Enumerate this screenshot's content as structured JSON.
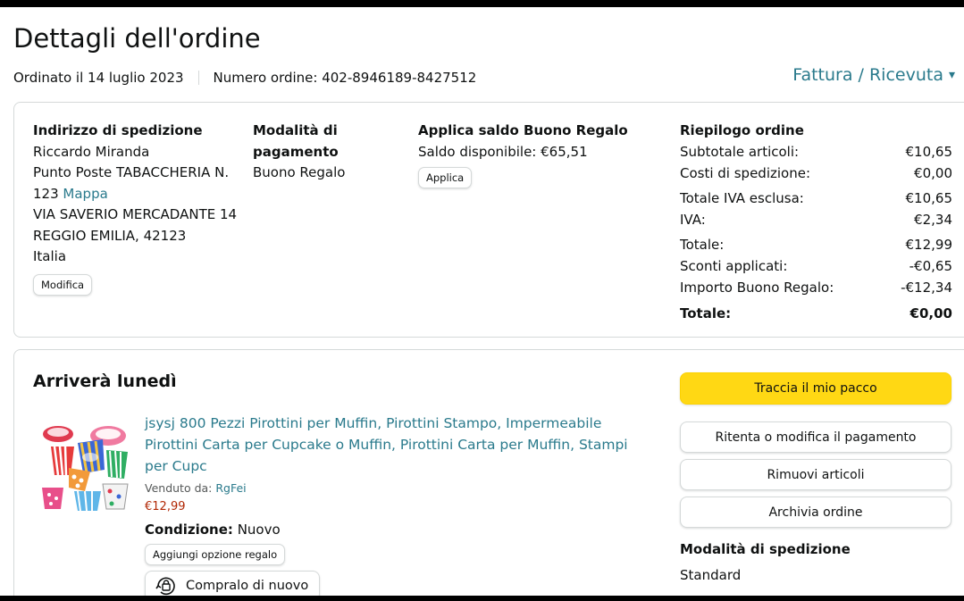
{
  "header": {
    "title": "Dettagli dell'ordine",
    "order_date": "Ordinato il 14 luglio 2023",
    "order_number": "Numero ordine: 402-8946189-8427512",
    "invoice_link": "Fattura / Ricevuta"
  },
  "shipping_address": {
    "heading": "Indirizzo di spedizione",
    "lines": [
      "Riccardo Miranda",
      "Punto Poste TABACCHERIA N.",
      "123"
    ],
    "map_link": "Mappa",
    "lines2": [
      "VIA SAVERIO MERCADANTE 14",
      "REGGIO EMILIA, 42123",
      "Italia"
    ],
    "edit_button": "Modifica"
  },
  "payment": {
    "heading_line1": "Modalità di",
    "heading_line2": "pagamento",
    "method": "Buono Regalo"
  },
  "gift_balance": {
    "heading": "Applica saldo Buono Regalo",
    "balance": "Saldo disponibile: €65,51",
    "apply_button": "Applica"
  },
  "summary": {
    "heading": "Riepilogo ordine",
    "rows": [
      {
        "label": "Subtotale articoli:",
        "value": "€10,65"
      },
      {
        "label": "Costi di spedizione:",
        "value": "€0,00"
      },
      {
        "label": "Totale IVA esclusa:",
        "value": "€10,65"
      },
      {
        "label": "IVA:",
        "value": "€2,34"
      },
      {
        "label": "Totale:",
        "value": "€12,99"
      },
      {
        "label": "Sconti applicati:",
        "value": "-€0,65"
      },
      {
        "label": "Importo Buono Regalo:",
        "value": "-€12,34"
      }
    ],
    "grand_total_label": "Totale:",
    "grand_total_value": "€0,00"
  },
  "shipment": {
    "heading": "Arriverà lunedì",
    "product": {
      "title": "jsysj 800 Pezzi Pirottini per Muffin, Pirottini Stampo, Impermeabile Pirottini Carta per Cupcake o Muffin, Pirottini Carta per Muffin, Stampi per Cupc",
      "sold_by_label": "Venduto da: ",
      "seller": "RgFei",
      "price": "€12,99",
      "condition_label": "Condizione:",
      "condition_value": "Nuovo",
      "gift_button": "Aggiungi opzione regalo",
      "rebuy_button": "Compralo di nuovo"
    },
    "actions": {
      "track": "Traccia il mio pacco",
      "retry_payment": "Ritenta o modifica il pagamento",
      "remove_items": "Rimuovi articoli",
      "archive": "Archivia ordine"
    },
    "shipping_mode_heading": "Modalità di spedizione",
    "shipping_mode": "Standard"
  },
  "colors": {
    "link": "#2a7a8c",
    "price": "#b12704",
    "primary_button": "#ffd814",
    "border": "#d5d9d9"
  }
}
